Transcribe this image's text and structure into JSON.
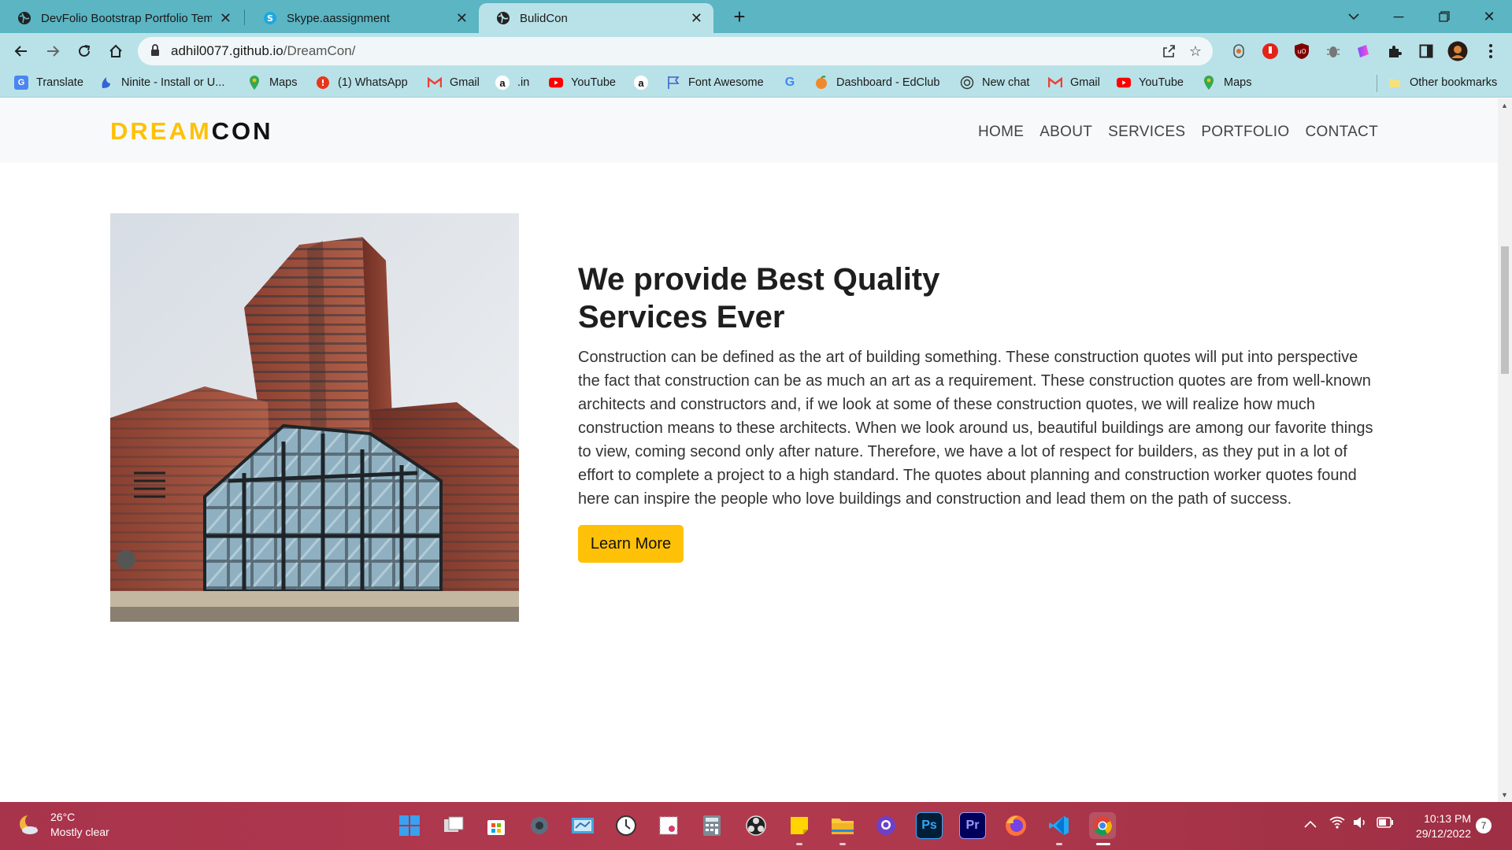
{
  "browser": {
    "tabs": [
      {
        "title": "DevFolio Bootstrap Portfolio Tem",
        "icon": "globe-icon"
      },
      {
        "title": "Skype.aassignment",
        "icon": "skype-icon"
      },
      {
        "title": "BulidCon",
        "icon": "globe-icon"
      }
    ],
    "address": {
      "domain": "adhil0077.github.io",
      "path": "/DreamCon/"
    },
    "bookmarks": [
      {
        "label": "Translate",
        "icon": "translate-icon"
      },
      {
        "label": "Ninite - Install or U...",
        "icon": "ninite-icon"
      },
      {
        "label": "Maps",
        "icon": "maps-icon"
      },
      {
        "label": "(1) WhatsApp",
        "icon": "whatsapp-icon"
      },
      {
        "label": "Gmail",
        "icon": "gmail-icon"
      },
      {
        "label": ".in",
        "icon": "amazon-icon"
      },
      {
        "label": "YouTube",
        "icon": "youtube-icon"
      },
      {
        "label": "",
        "icon": "amazon-icon"
      },
      {
        "label": "Font Awesome",
        "icon": "flag-icon"
      },
      {
        "label": "",
        "icon": "google-icon"
      },
      {
        "label": "Dashboard - EdClub",
        "icon": "edclub-icon"
      },
      {
        "label": "New chat",
        "icon": "openai-icon"
      },
      {
        "label": "Gmail",
        "icon": "gmail-icon"
      },
      {
        "label": "YouTube",
        "icon": "youtube-icon"
      },
      {
        "label": "Maps",
        "icon": "maps-icon"
      },
      {
        "label": "Other bookmarks",
        "icon": "folder-icon"
      }
    ]
  },
  "site": {
    "brand": {
      "part1": "DREAM",
      "part2": "CON"
    },
    "nav": [
      "HOME",
      "ABOUT",
      "SERVICES",
      "PORTFOLIO",
      "CONTACT"
    ],
    "heading": "We provide Best Quality Services Ever",
    "description": "Construction can be defined as the art of building something. These construction quotes will put into perspective the fact that construction can be as much an art as a requirement. These construction quotes are from well-known architects and constructors and, if we look at some of these construction quotes, we will realize how much construction means to these architects. When we look around us, beautiful buildings are among our favorite things to view, coming second only after nature. Therefore, we have a lot of respect for builders, as they put in a lot of effort to complete a project to a high standard. The quotes about planning and construction worker quotes found here can inspire the people who love buildings and construction and lead them on the path of success.",
    "button": "Learn More"
  },
  "taskbar": {
    "weather": {
      "temp": "26°C",
      "condition": "Mostly clear"
    },
    "time": "10:13 PM",
    "date": "29/12/2022",
    "notifications": "7"
  },
  "colors": {
    "accent": "#ffc107",
    "tabbar": "#5bb5c3",
    "toolbar": "#b9e2e8",
    "taskbar": "#a8344c"
  }
}
